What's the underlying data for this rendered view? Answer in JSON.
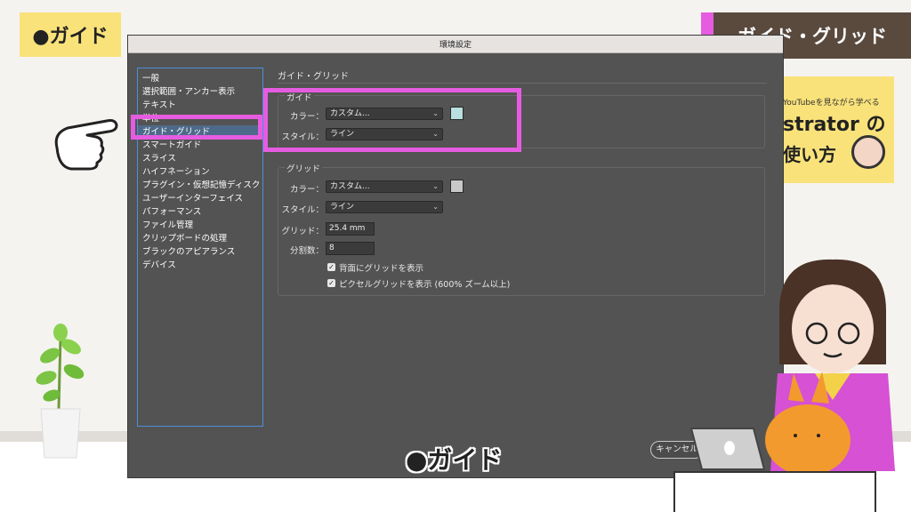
{
  "overlay": {
    "corner_badge": "●ガイド",
    "title_banner": "ガイド・グリッド",
    "promo_line1": "YouTubeを見ながら学べる",
    "promo_line2": "strator の",
    "promo_line3": "使い方",
    "caption": "●ガイド"
  },
  "dialog": {
    "title": "環境設定",
    "sidebar": [
      "一般",
      "選択範囲・アンカー表示",
      "テキスト",
      "単位",
      "ガイド・グリッド",
      "スマートガイド",
      "スライス",
      "ハイフネーション",
      "プラグイン・仮想記憶ディスク",
      "ユーザーインターフェイス",
      "パフォーマンス",
      "ファイル管理",
      "クリップボードの処理",
      "ブラックのアピアランス",
      "デバイス"
    ],
    "active_index": 4,
    "section_title": "ガイド・グリッド",
    "guide": {
      "label": "ガイド",
      "color_label": "カラー：",
      "color_value": "カスタム...",
      "style_label": "スタイル：",
      "style_value": "ライン",
      "swatch_color": "#b9dfe0"
    },
    "grid": {
      "label": "グリッド",
      "color_label": "カラー：",
      "color_value": "カスタム...",
      "style_label": "スタイル：",
      "style_value": "ライン",
      "gridline_label": "グリッド：",
      "gridline_value": "25.4 mm",
      "subdiv_label": "分割数：",
      "subdiv_value": "8",
      "swatch_color": "#c8c8c8",
      "check_back": "背面にグリッドを表示",
      "check_pixel": "ピクセルグリッドを表示 (600% ズーム以上)"
    },
    "cancel_label": "キャンセル"
  },
  "colors": {
    "highlight": "#e65ce0",
    "banner_bg": "#5a4a3e",
    "badge_bg": "#f9e27a"
  }
}
